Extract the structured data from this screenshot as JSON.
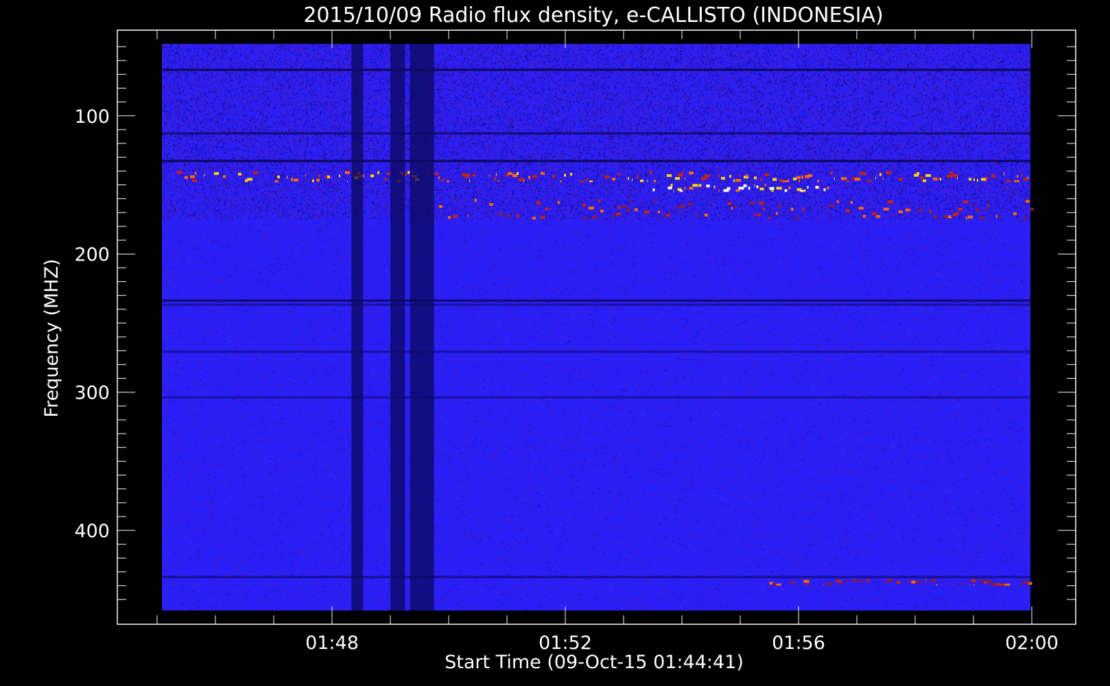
{
  "chart_data": {
    "type": "heatmap",
    "title": "2015/10/09  Radio flux density, e-CALLISTO (INDONESIA)",
    "xlabel": "Start Time (09-Oct-15 01:44:41)",
    "ylabel": "Frequency (MHZ)",
    "x_ticks": [
      "01:48",
      "01:52",
      "01:56",
      "02:00"
    ],
    "y_ticks": [
      100,
      200,
      300,
      400
    ],
    "x_range": [
      "01:44:41",
      "02:00:00"
    ],
    "ylim": [
      48,
      458
    ],
    "y_inverted": true,
    "colorscale": [
      "#000000",
      "#1010a0",
      "#2222ff",
      "#7a1870",
      "#cc2200",
      "#ff6a00",
      "#ffd400",
      "#ffffff"
    ],
    "bursts": [
      {
        "freq_start": 140,
        "freq_end": 148,
        "time_start": "01:44:41",
        "time_end": "02:00:00",
        "level": "strong"
      },
      {
        "freq_start": 149,
        "freq_end": 155,
        "time_start": "01:53:30",
        "time_end": "01:56:30",
        "level": "very strong"
      },
      {
        "freq_start": 160,
        "freq_end": 175,
        "time_start": "01:49:50",
        "time_end": "02:00:00",
        "level": "moderate"
      },
      {
        "freq_start": 435,
        "freq_end": 440,
        "time_start": "01:55:30",
        "time_end": "02:00:00",
        "level": "moderate"
      }
    ],
    "dark_bands": [
      {
        "time_start": "01:48:20",
        "time_end": "01:48:32"
      },
      {
        "time_start": "01:49:00",
        "time_end": "01:49:15"
      },
      {
        "time_start": "01:49:20",
        "time_end": "01:49:45"
      }
    ]
  }
}
